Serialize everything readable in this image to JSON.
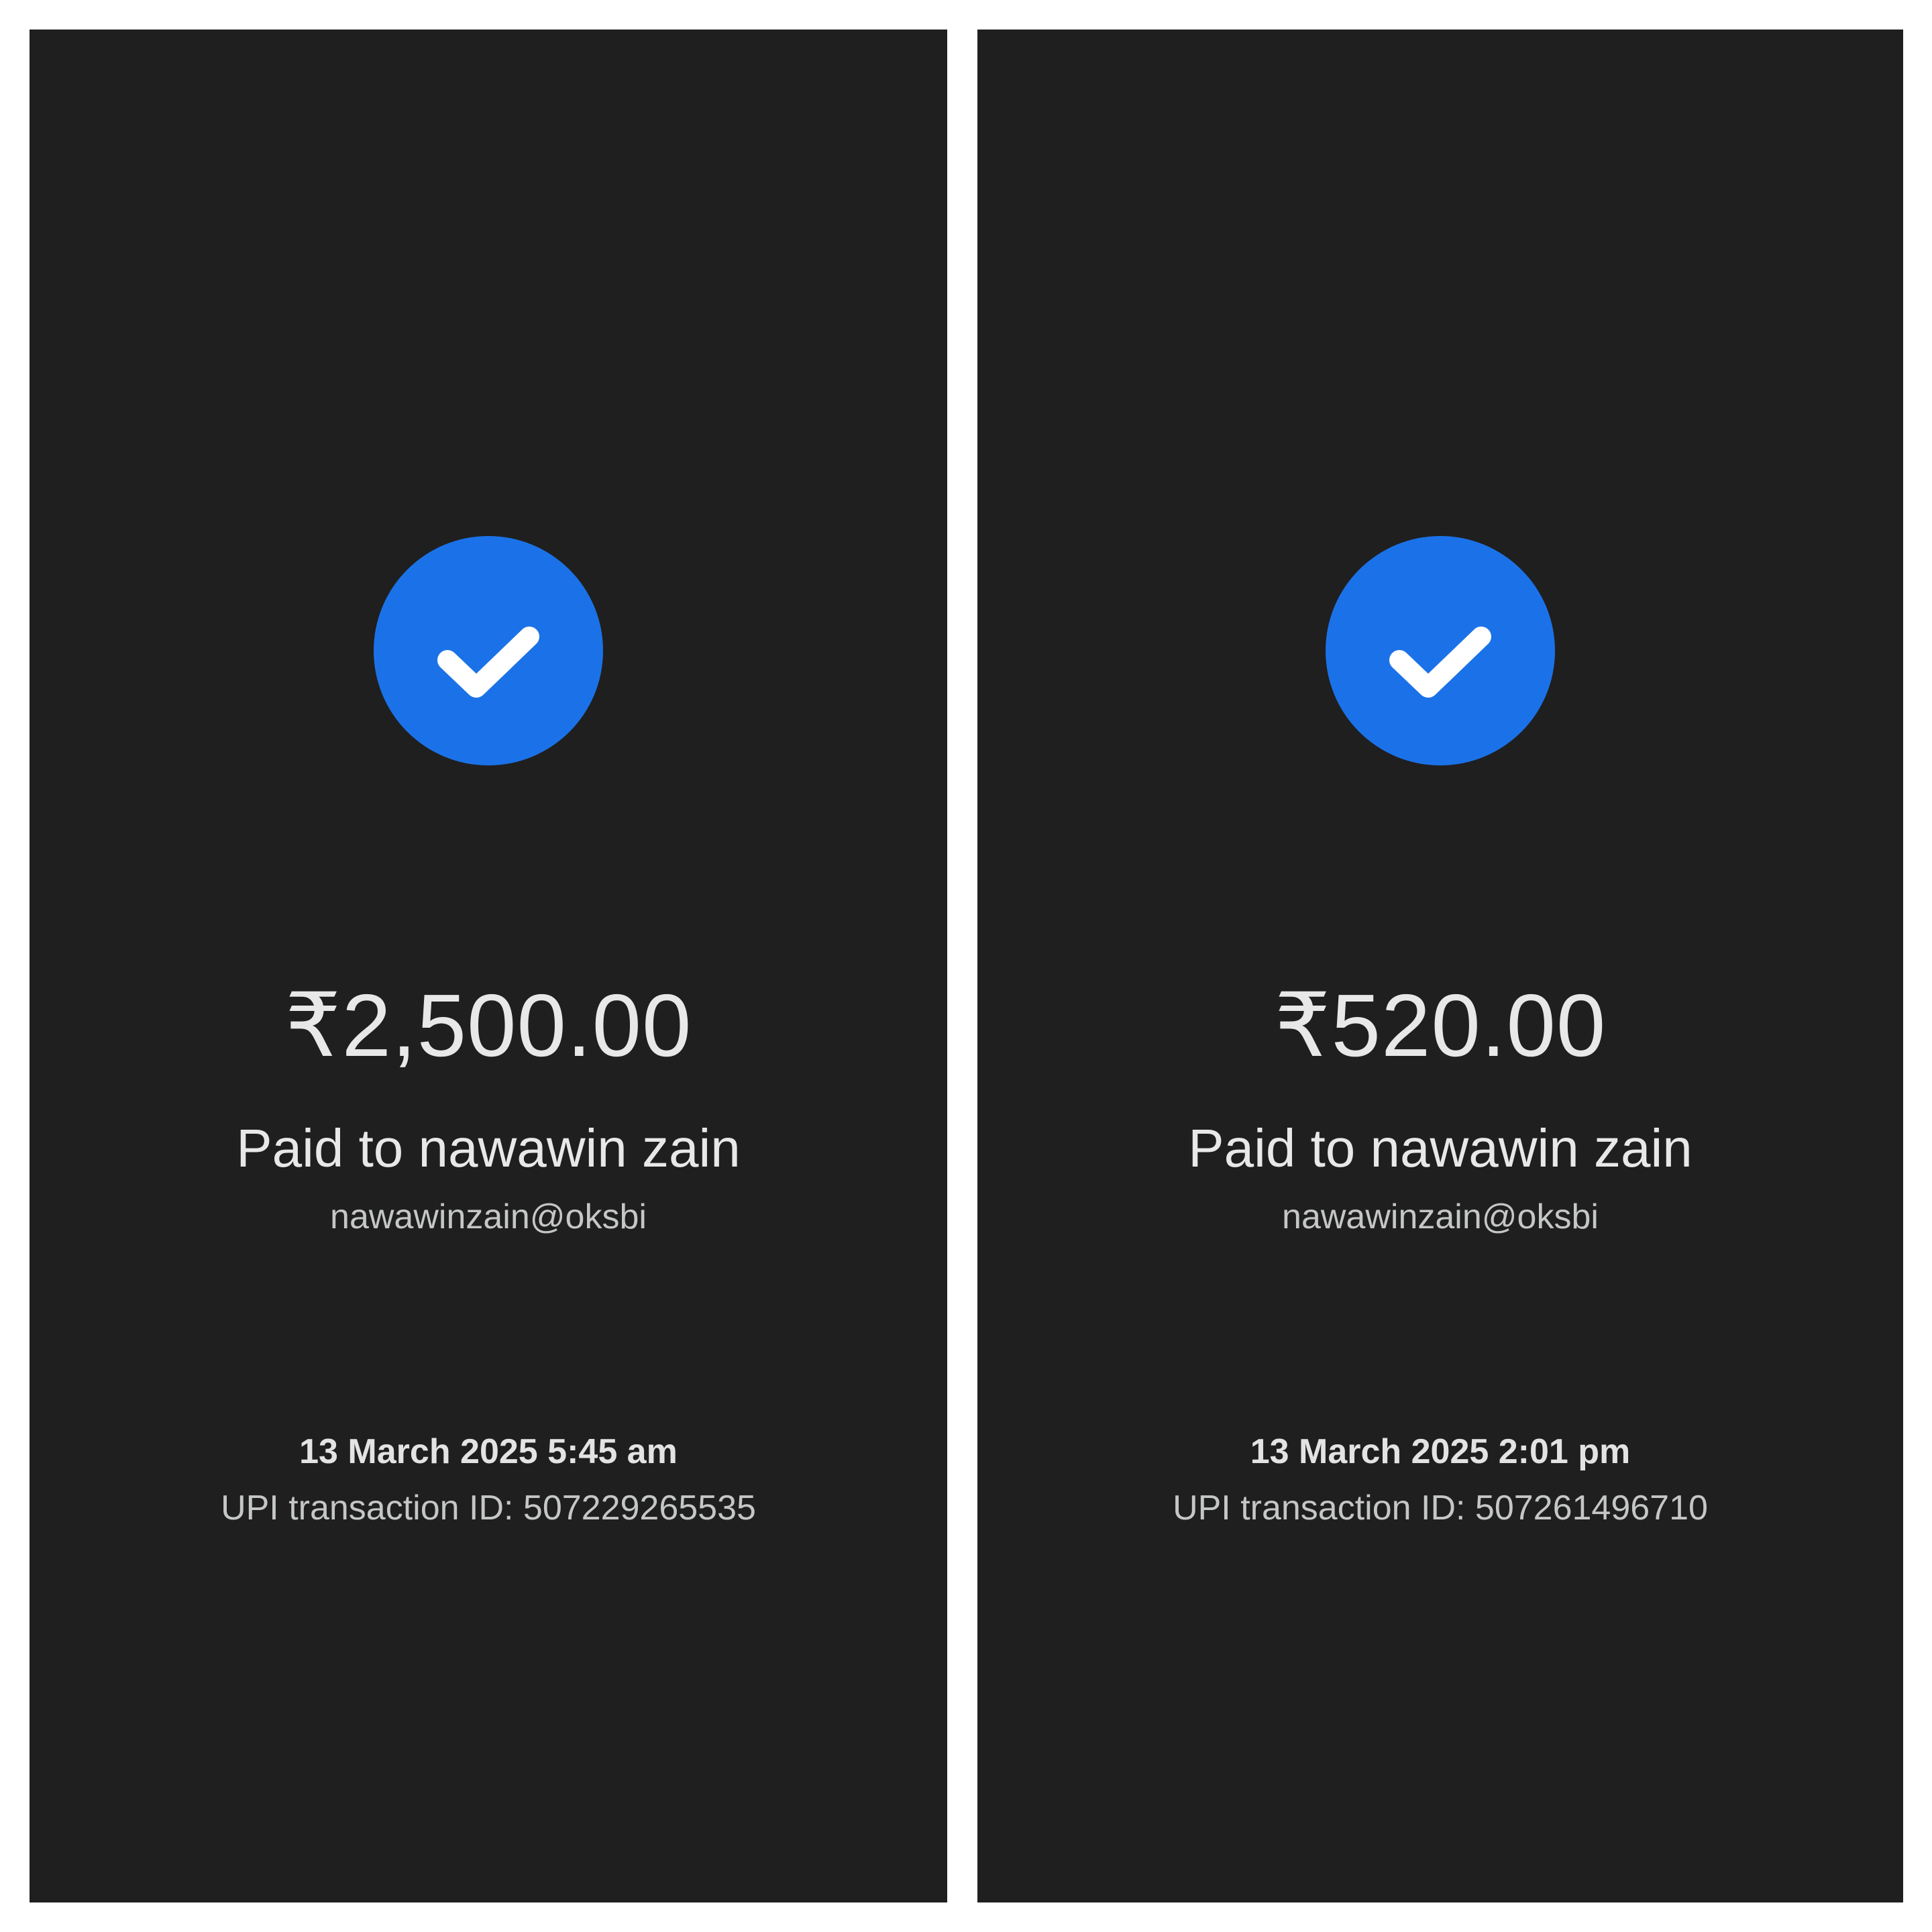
{
  "colors": {
    "background": "#1f1f1f",
    "accent_check": "#1b72e8",
    "frame": "#ffffff"
  },
  "receipts": [
    {
      "status_icon": "check-icon",
      "amount": "₹2,500.00",
      "paid_to": "Paid to nawawin zain",
      "upi_handle": "nawawinzain@oksbi",
      "datetime": "13 March 2025 5:45 am",
      "transaction_id": "UPI transaction ID: 507229265535"
    },
    {
      "status_icon": "check-icon",
      "amount": "₹520.00",
      "paid_to": "Paid to nawawin zain",
      "upi_handle": "nawawinzain@oksbi",
      "datetime": "13 March 2025 2:01 pm",
      "transaction_id": "UPI transaction ID: 507261496710"
    }
  ]
}
